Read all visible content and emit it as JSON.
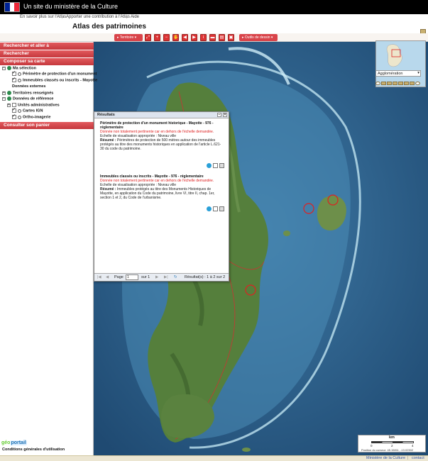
{
  "header": {
    "site_title": "Un site du ministère de la Culture",
    "links": [
      "En savoir plus sur l'Atlas",
      "Apporter une contribution à l'Atlas",
      "Aide"
    ],
    "atlas_title": "Atlas des patrimoines"
  },
  "toolbar": {
    "territoires_label": "Territoire",
    "outils_label": "Outils de dessin"
  },
  "sidebar": {
    "sections": {
      "rechercher_aller": "Rechercher et aller à",
      "rechercher": "Rechercher",
      "composer": "Composer sa carte",
      "consulter": "Consulter son panier"
    },
    "tree": {
      "ma_selection": "Ma sélection",
      "layer1": "Périmètre de protection d'un monument",
      "layer2": "Immeubles classés ou inscrits - Mayotte",
      "donnees_externes": "Données externes",
      "territoires": "Territoires renseignés",
      "donnees_reference": "Données de référence",
      "unites": "Unités administratives",
      "cartes_ign": "Cartes IGN",
      "ortho": "Ortho-imagerie"
    },
    "cgu": "Conditions générales d'utilisation"
  },
  "logo": {
    "g": "géo",
    "p": "portail"
  },
  "overview": {
    "scale_value": "Agglomération"
  },
  "results": {
    "title": "Résultats",
    "items": [
      {
        "title": "Périmètre de protection d'un monument historique - Mayotte - 976 - réglementaire",
        "warning": "Donnée non totalement pertinente car en dehors de l'échelle demandée.",
        "scale": "Echelle de visualisation appropriée : Niveau ville",
        "resume_label": "Résumé :",
        "resume": "Périmètres de protection de 500 mètres autour des immeubles protégés au titre des monuments historiques en application de l'article L.621-30 du code du patrimoine."
      },
      {
        "title": "Immeubles classés ou inscrits - Mayotte - 976 - réglementaire",
        "warning": "Donnée non totalement pertinente car en dehors de l'échelle demandée.",
        "scale": "Echelle de visualisation appropriée : Niveau ville",
        "resume_label": "Résumé :",
        "resume": "Immeubles protégés au titre des Monuments Historiques de Mayotte, en application du Code du patrimoine, livre VI, titre II, chap. 1er, section 1 et 2, du Code de l'urbanisme."
      }
    ],
    "page_label": "Page",
    "page_value": "1",
    "of_label": "sur 1",
    "count": "Résultat(s) : 1 à 2 sur 2"
  },
  "scalebar": {
    "unit": "km",
    "ticks": [
      "0",
      "2",
      "4"
    ],
    "position": "Position du curseur: 45.15811, -13.02302"
  },
  "footer": {
    "ministere": "Ministère de la Culture",
    "contact": "contact"
  },
  "colors": {
    "accent": "#d9444a",
    "sea": "#2d5e86",
    "land": "#4f7a3a"
  }
}
